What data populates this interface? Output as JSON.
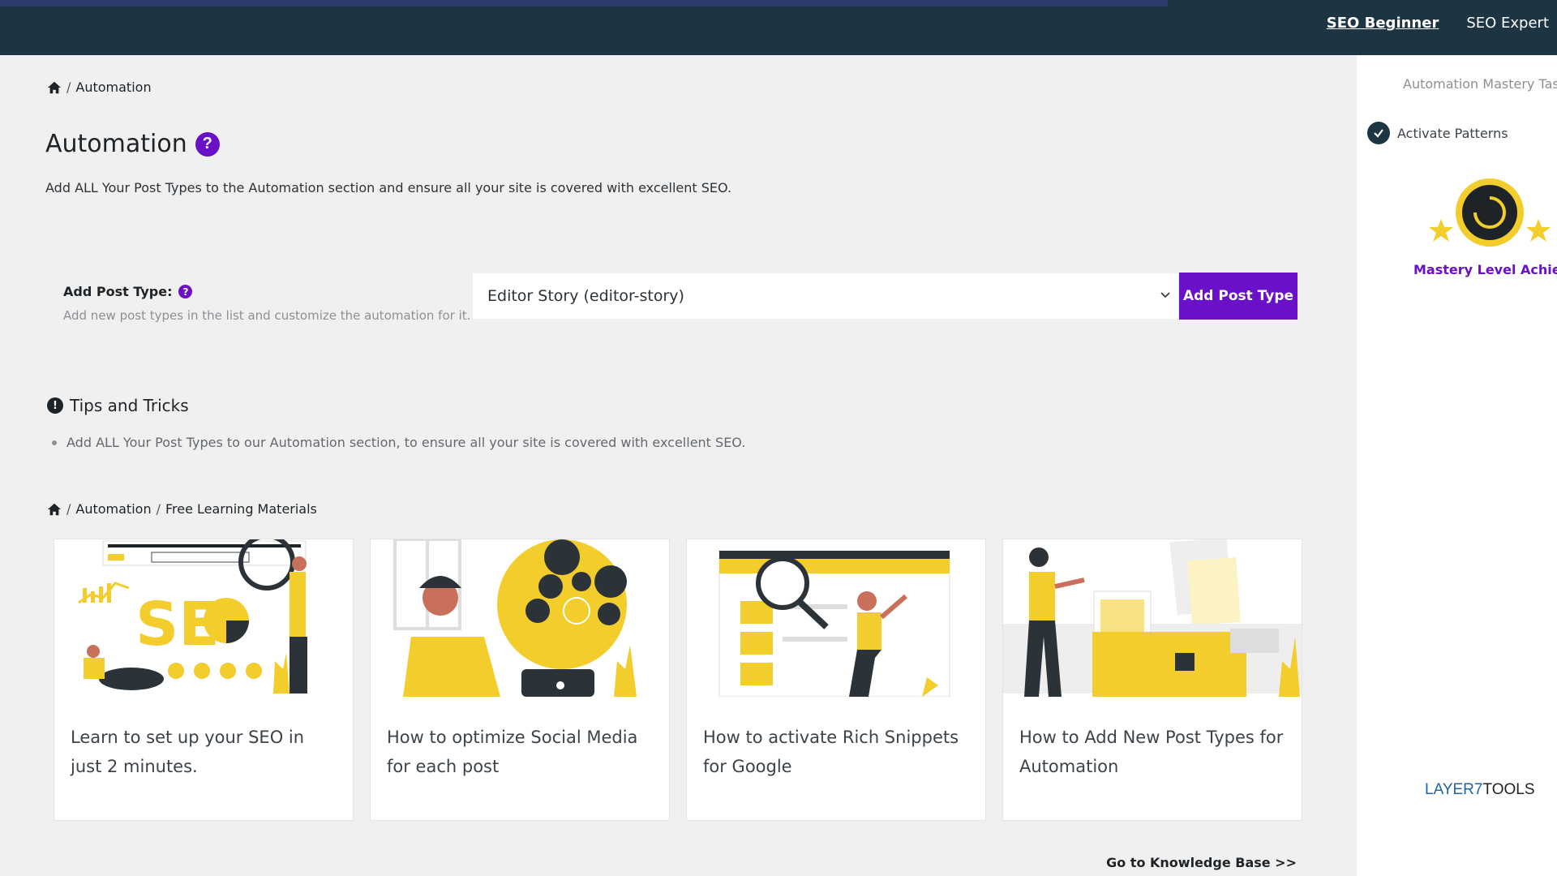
{
  "topbar": {
    "links": [
      {
        "label": "SEO Beginner",
        "active": true
      },
      {
        "label": "SEO Expert",
        "active": false
      }
    ]
  },
  "breadcrumb1": {
    "items": [
      "Automation"
    ]
  },
  "page": {
    "title": "Automation",
    "help": "?",
    "description": "Add ALL Your Post Types to the Automation section and ensure all your site is covered with excellent SEO."
  },
  "add_post_type": {
    "label": "Add Post Type:",
    "help": "?",
    "sublabel": "Add new post types in the list and customize the automation for it.",
    "selected": "Editor Story (editor-story)",
    "button": "Add Post Type"
  },
  "tips": {
    "title": "Tips and Tricks",
    "icon": "!",
    "items": [
      "Add ALL Your Post Types to our Automation section, to ensure all your site is covered with excellent SEO."
    ]
  },
  "breadcrumb2": {
    "items": [
      "Automation",
      "Free Learning Materials"
    ]
  },
  "cards": [
    {
      "title": "Learn to set up your SEO in just 2 minutes.",
      "thumb_text": "SE",
      "icon": "seo-illustration"
    },
    {
      "title": "How to optimize Social Media for each post",
      "icon": "social-media-illustration"
    },
    {
      "title": "How to activate Rich Snippets for Google",
      "icon": "rich-snippets-illustration"
    },
    {
      "title": "How to Add New Post Types for Automation",
      "icon": "post-types-illustration"
    }
  ],
  "kb_link": "Go to Knowledge Base >>",
  "right_panel": {
    "tasks_title": "Automation Mastery Tas",
    "task": "Activate Patterns",
    "mastery": "Mastery Level Achieved",
    "brand_a": "LAYER7",
    "brand_b": "TOOLS"
  },
  "colors": {
    "accent": "#6b10c9",
    "topbar": "#1d3443",
    "illustration_yellow": "#f2cd2c"
  }
}
